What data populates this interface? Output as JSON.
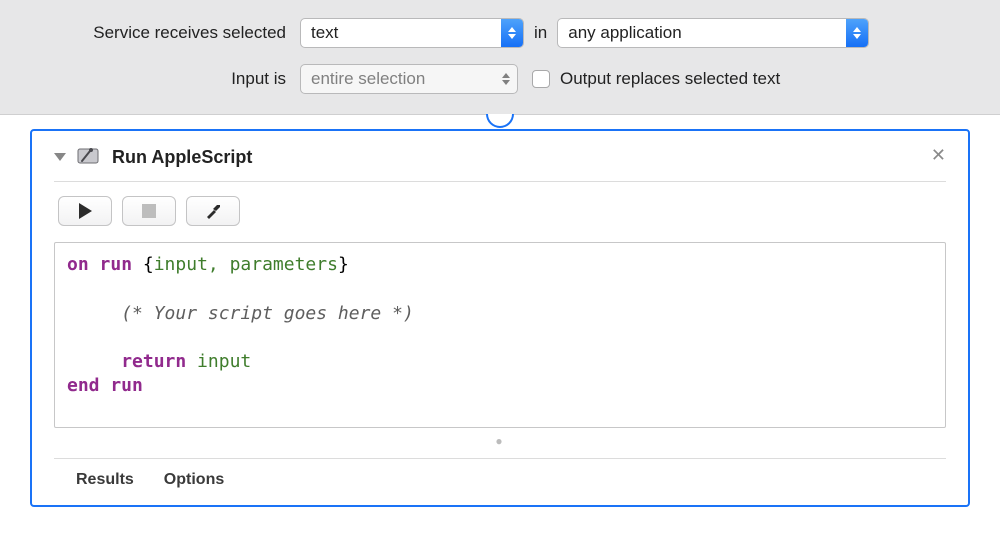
{
  "header": {
    "row1_label": "Service receives selected",
    "input_type": "text",
    "in_word": "in",
    "app_scope": "any application",
    "row2_label": "Input is",
    "selection_mode": "entire selection",
    "checkbox_label": "Output replaces selected text"
  },
  "action": {
    "title": "Run AppleScript",
    "script": {
      "l1_kw": "on",
      "l1_fn": " run ",
      "l1_br_open": "{",
      "l1_vars": "input, parameters",
      "l1_br_close": "}",
      "l2_comment": "(* Your script goes here *)",
      "l3_kw": "return",
      "l3_var": " input",
      "l4": "end run"
    },
    "footer": {
      "results": "Results",
      "options": "Options"
    }
  }
}
